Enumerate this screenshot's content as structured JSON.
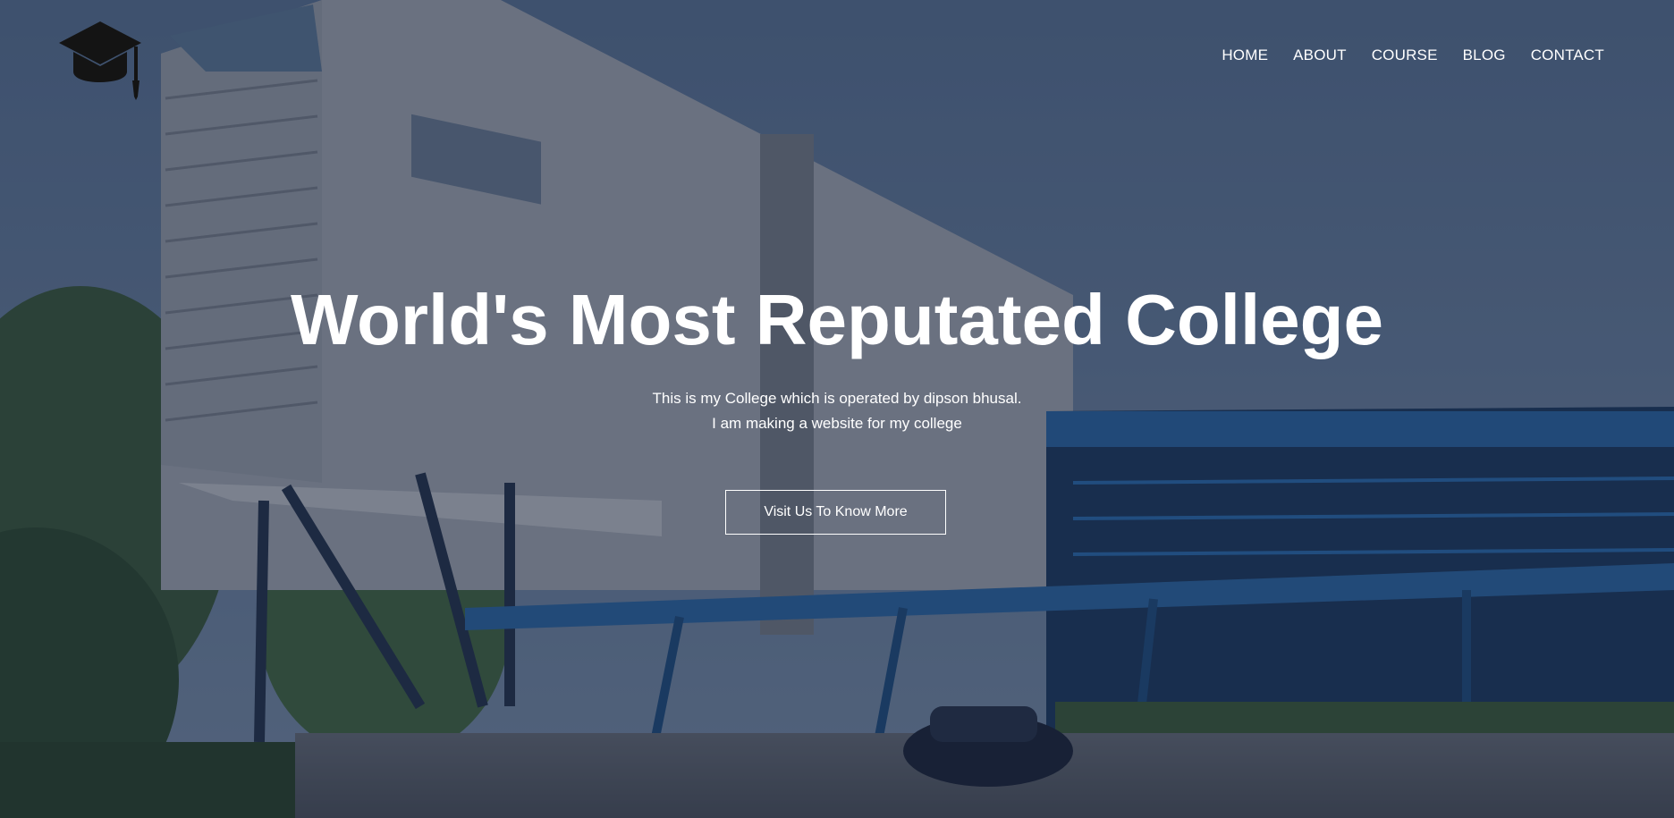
{
  "brand": {
    "logo_icon": "graduation-cap-icon"
  },
  "nav": {
    "items": [
      {
        "label": "HOME"
      },
      {
        "label": "ABOUT"
      },
      {
        "label": "COURSE"
      },
      {
        "label": "BLOG"
      },
      {
        "label": "CONTACT"
      }
    ]
  },
  "hero": {
    "headline": "World's Most Reputated College",
    "subtext_line1": "This is my College which is operated by dipson bhusal.",
    "subtext_line2": "I am making a website for my college",
    "cta_label": "Visit Us To Know More"
  },
  "colors": {
    "overlay": "#1e2a44",
    "text": "#ffffff",
    "logo": "#1a1a1a",
    "building_accent": "#1f5fa0"
  }
}
